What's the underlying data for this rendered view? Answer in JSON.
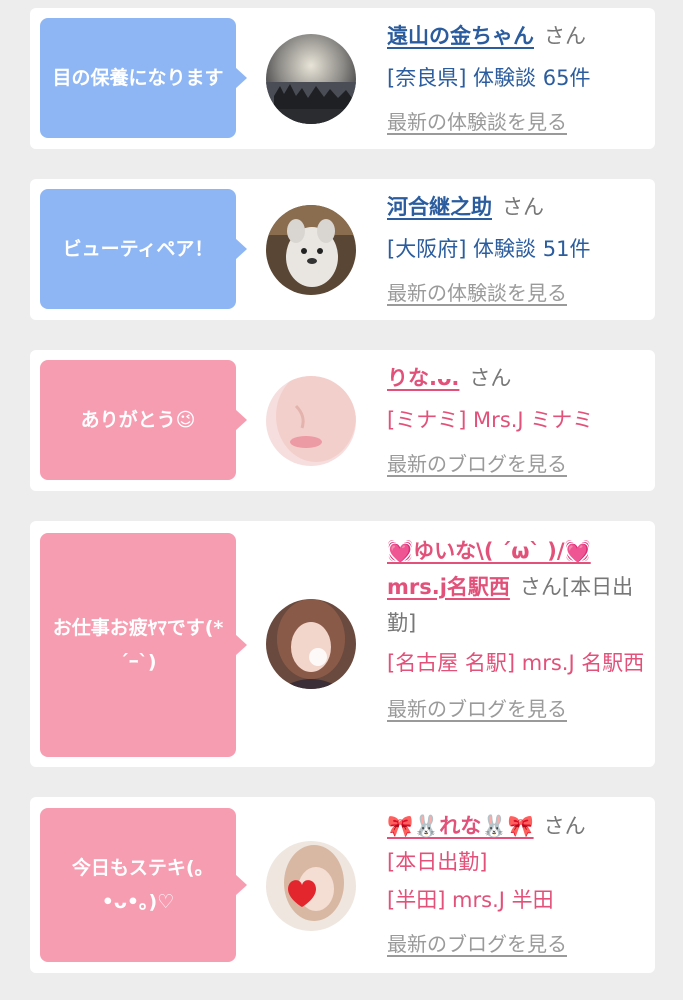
{
  "cards": [
    {
      "message": "目の保養になります",
      "name": "遠山の金ちゃん",
      "san": "さん",
      "detail": "[奈良県] 体験談 65件",
      "link": "最新の体験談を見る"
    },
    {
      "message": "ビューティペア！",
      "name": "河合継之助",
      "san": "さん",
      "detail": "[大阪府] 体験談 51件",
      "link": "最新の体験談を見る"
    },
    {
      "message": "ありがとう😉",
      "name": "りな.ᴗ.",
      "san": "さん",
      "detail": "[ミナミ] Mrs.J ミナミ",
      "link": "最新のブログを見る"
    },
    {
      "message": "お仕事お疲ﾔﾏです(*´ｰ`)",
      "name": "💓ゆいな\\( ´ω` )/💓mrs.j名駅西",
      "san": "さん",
      "extra": "[本日出勤]",
      "detail": "[名古屋 名駅] mrs.J 名駅西",
      "link": "最新のブログを見る"
    },
    {
      "message": "今日もステキ(｡•ᴗ•｡)♡",
      "name": "🎀🐰れな🐰🎀",
      "san": "さん",
      "extra": "[本日出勤]",
      "detail": "[半田] mrs.J 半田",
      "link": "最新のブログを見る"
    }
  ],
  "colors": {
    "blue_bubble": "#8fb6f4",
    "pink_bubble": "#f79db1",
    "blue_text": "#2a5c9e",
    "pink_text": "#e2517a",
    "link_gray": "#9a9a9a"
  },
  "avatars": [
    "landscape-photo",
    "stuffed-animal-photo",
    "face-closeup-photo",
    "girl-photo",
    "girl-heart-photo"
  ]
}
